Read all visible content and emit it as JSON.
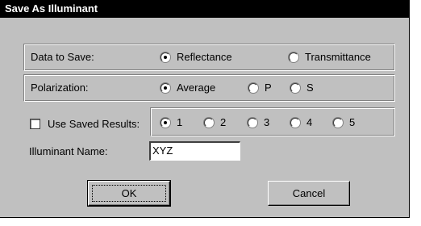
{
  "window": {
    "title": "Save As Illuminant"
  },
  "data_to_save": {
    "label": "Data to Save:",
    "options": [
      "Reflectance",
      "Transmittance"
    ],
    "selected": "Reflectance"
  },
  "polarization": {
    "label": "Polarization:",
    "options": [
      "Average",
      "P",
      "S"
    ],
    "selected": "Average"
  },
  "saved_results": {
    "checkbox_label": "Use Saved Results:",
    "checked": false,
    "options": [
      "1",
      "2",
      "3",
      "4",
      "5"
    ],
    "selected": "1"
  },
  "illuminant_name": {
    "label": "Illuminant Name:",
    "value": "XYZ"
  },
  "buttons": {
    "ok": "OK",
    "cancel": "Cancel"
  }
}
